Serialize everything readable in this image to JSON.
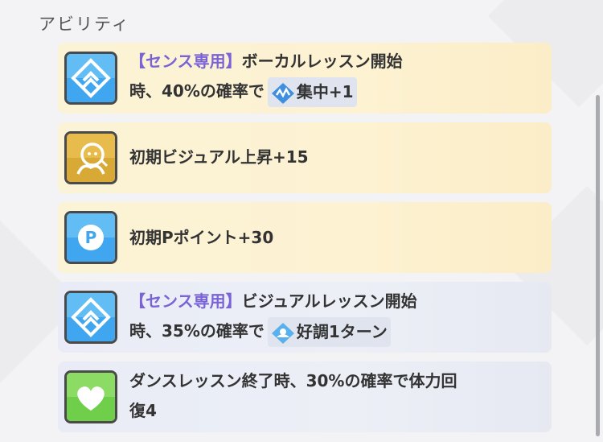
{
  "section": {
    "title": "アビリティ"
  },
  "abilities": [
    {
      "icon": "double-chevron-diamond-icon",
      "tag": "【センス専用】",
      "line1_rest": "ボーカルレッスン開始",
      "line2_before": "時、40%の確率で",
      "badge_icon": "concentration-icon",
      "badge_text": "集中+1"
    },
    {
      "icon": "visual-face-icon",
      "text": "初期ビジュアル上昇+15"
    },
    {
      "icon": "p-point-icon",
      "text": "初期Pポイント+30"
    },
    {
      "icon": "double-chevron-diamond-icon",
      "tag": "【センス専用】",
      "line1_rest": "ビジュアルレッスン開始",
      "line2_before": "時、35%の確率で",
      "badge_icon": "good-condition-icon",
      "badge_text": "好調1ターン"
    },
    {
      "icon": "heart-icon",
      "line1": "ダンスレッスン終了時、30%の確率で体力回",
      "line2": "復4"
    }
  ],
  "colors": {
    "tag": "#7a63d6",
    "card_gold": "#fbf3d6",
    "card_blue": "#e9ecf6",
    "icon_blue": "#46a9ee",
    "icon_gold": "#d9a936",
    "icon_green": "#6fce4a"
  }
}
